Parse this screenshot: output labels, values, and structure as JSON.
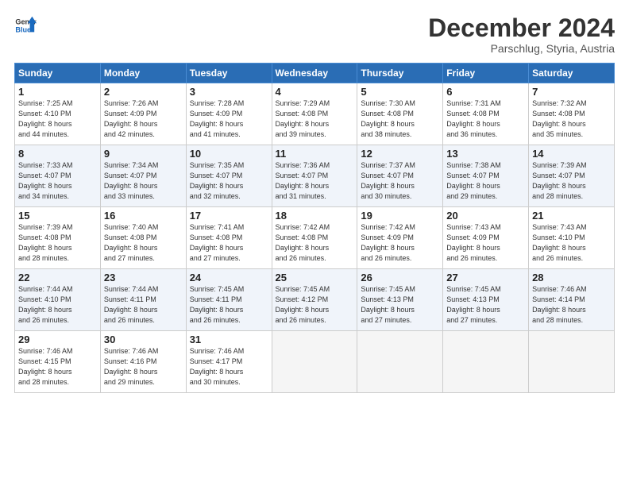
{
  "logo": {
    "line1": "General",
    "line2": "Blue"
  },
  "title": "December 2024",
  "subtitle": "Parschlug, Styria, Austria",
  "headers": [
    "Sunday",
    "Monday",
    "Tuesday",
    "Wednesday",
    "Thursday",
    "Friday",
    "Saturday"
  ],
  "weeks": [
    [
      {
        "day": "1",
        "lines": [
          "Sunrise: 7:25 AM",
          "Sunset: 4:10 PM",
          "Daylight: 8 hours",
          "and 44 minutes."
        ]
      },
      {
        "day": "2",
        "lines": [
          "Sunrise: 7:26 AM",
          "Sunset: 4:09 PM",
          "Daylight: 8 hours",
          "and 42 minutes."
        ]
      },
      {
        "day": "3",
        "lines": [
          "Sunrise: 7:28 AM",
          "Sunset: 4:09 PM",
          "Daylight: 8 hours",
          "and 41 minutes."
        ]
      },
      {
        "day": "4",
        "lines": [
          "Sunrise: 7:29 AM",
          "Sunset: 4:08 PM",
          "Daylight: 8 hours",
          "and 39 minutes."
        ]
      },
      {
        "day": "5",
        "lines": [
          "Sunrise: 7:30 AM",
          "Sunset: 4:08 PM",
          "Daylight: 8 hours",
          "and 38 minutes."
        ]
      },
      {
        "day": "6",
        "lines": [
          "Sunrise: 7:31 AM",
          "Sunset: 4:08 PM",
          "Daylight: 8 hours",
          "and 36 minutes."
        ]
      },
      {
        "day": "7",
        "lines": [
          "Sunrise: 7:32 AM",
          "Sunset: 4:08 PM",
          "Daylight: 8 hours",
          "and 35 minutes."
        ]
      }
    ],
    [
      {
        "day": "8",
        "lines": [
          "Sunrise: 7:33 AM",
          "Sunset: 4:07 PM",
          "Daylight: 8 hours",
          "and 34 minutes."
        ]
      },
      {
        "day": "9",
        "lines": [
          "Sunrise: 7:34 AM",
          "Sunset: 4:07 PM",
          "Daylight: 8 hours",
          "and 33 minutes."
        ]
      },
      {
        "day": "10",
        "lines": [
          "Sunrise: 7:35 AM",
          "Sunset: 4:07 PM",
          "Daylight: 8 hours",
          "and 32 minutes."
        ]
      },
      {
        "day": "11",
        "lines": [
          "Sunrise: 7:36 AM",
          "Sunset: 4:07 PM",
          "Daylight: 8 hours",
          "and 31 minutes."
        ]
      },
      {
        "day": "12",
        "lines": [
          "Sunrise: 7:37 AM",
          "Sunset: 4:07 PM",
          "Daylight: 8 hours",
          "and 30 minutes."
        ]
      },
      {
        "day": "13",
        "lines": [
          "Sunrise: 7:38 AM",
          "Sunset: 4:07 PM",
          "Daylight: 8 hours",
          "and 29 minutes."
        ]
      },
      {
        "day": "14",
        "lines": [
          "Sunrise: 7:39 AM",
          "Sunset: 4:07 PM",
          "Daylight: 8 hours",
          "and 28 minutes."
        ]
      }
    ],
    [
      {
        "day": "15",
        "lines": [
          "Sunrise: 7:39 AM",
          "Sunset: 4:08 PM",
          "Daylight: 8 hours",
          "and 28 minutes."
        ]
      },
      {
        "day": "16",
        "lines": [
          "Sunrise: 7:40 AM",
          "Sunset: 4:08 PM",
          "Daylight: 8 hours",
          "and 27 minutes."
        ]
      },
      {
        "day": "17",
        "lines": [
          "Sunrise: 7:41 AM",
          "Sunset: 4:08 PM",
          "Daylight: 8 hours",
          "and 27 minutes."
        ]
      },
      {
        "day": "18",
        "lines": [
          "Sunrise: 7:42 AM",
          "Sunset: 4:08 PM",
          "Daylight: 8 hours",
          "and 26 minutes."
        ]
      },
      {
        "day": "19",
        "lines": [
          "Sunrise: 7:42 AM",
          "Sunset: 4:09 PM",
          "Daylight: 8 hours",
          "and 26 minutes."
        ]
      },
      {
        "day": "20",
        "lines": [
          "Sunrise: 7:43 AM",
          "Sunset: 4:09 PM",
          "Daylight: 8 hours",
          "and 26 minutes."
        ]
      },
      {
        "day": "21",
        "lines": [
          "Sunrise: 7:43 AM",
          "Sunset: 4:10 PM",
          "Daylight: 8 hours",
          "and 26 minutes."
        ]
      }
    ],
    [
      {
        "day": "22",
        "lines": [
          "Sunrise: 7:44 AM",
          "Sunset: 4:10 PM",
          "Daylight: 8 hours",
          "and 26 minutes."
        ]
      },
      {
        "day": "23",
        "lines": [
          "Sunrise: 7:44 AM",
          "Sunset: 4:11 PM",
          "Daylight: 8 hours",
          "and 26 minutes."
        ]
      },
      {
        "day": "24",
        "lines": [
          "Sunrise: 7:45 AM",
          "Sunset: 4:11 PM",
          "Daylight: 8 hours",
          "and 26 minutes."
        ]
      },
      {
        "day": "25",
        "lines": [
          "Sunrise: 7:45 AM",
          "Sunset: 4:12 PM",
          "Daylight: 8 hours",
          "and 26 minutes."
        ]
      },
      {
        "day": "26",
        "lines": [
          "Sunrise: 7:45 AM",
          "Sunset: 4:13 PM",
          "Daylight: 8 hours",
          "and 27 minutes."
        ]
      },
      {
        "day": "27",
        "lines": [
          "Sunrise: 7:45 AM",
          "Sunset: 4:13 PM",
          "Daylight: 8 hours",
          "and 27 minutes."
        ]
      },
      {
        "day": "28",
        "lines": [
          "Sunrise: 7:46 AM",
          "Sunset: 4:14 PM",
          "Daylight: 8 hours",
          "and 28 minutes."
        ]
      }
    ],
    [
      {
        "day": "29",
        "lines": [
          "Sunrise: 7:46 AM",
          "Sunset: 4:15 PM",
          "Daylight: 8 hours",
          "and 28 minutes."
        ]
      },
      {
        "day": "30",
        "lines": [
          "Sunrise: 7:46 AM",
          "Sunset: 4:16 PM",
          "Daylight: 8 hours",
          "and 29 minutes."
        ]
      },
      {
        "day": "31",
        "lines": [
          "Sunrise: 7:46 AM",
          "Sunset: 4:17 PM",
          "Daylight: 8 hours",
          "and 30 minutes."
        ]
      },
      null,
      null,
      null,
      null
    ]
  ]
}
